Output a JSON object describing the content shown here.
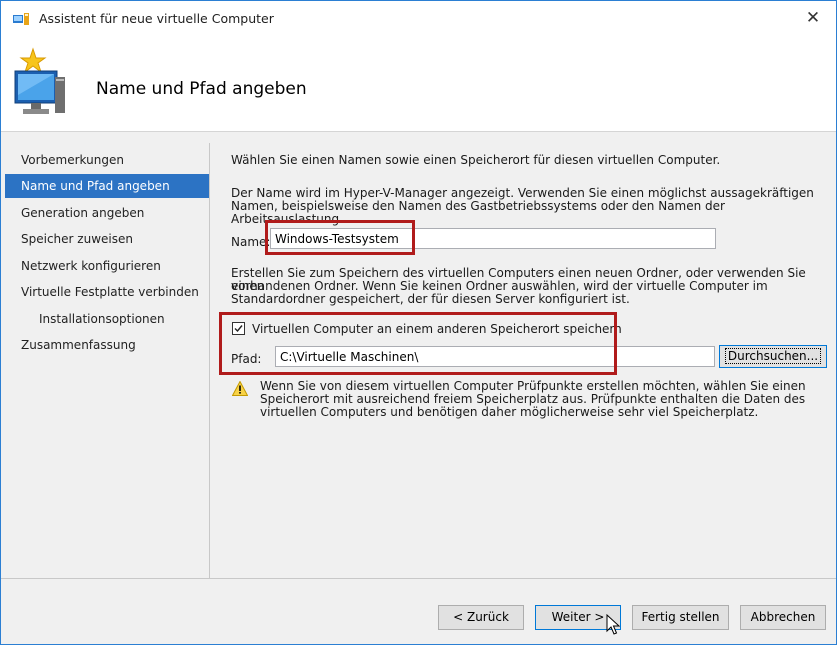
{
  "window": {
    "title": "Assistent für neue virtuelle Computer",
    "close_glyph": "✕"
  },
  "header": {
    "title": "Name und Pfad angeben",
    "icon": "monitor-star-icon"
  },
  "sidebar": {
    "items": [
      {
        "label": "Vorbemerkungen",
        "active": false,
        "indent": false
      },
      {
        "label": "Name und Pfad angeben",
        "active": true,
        "indent": false
      },
      {
        "label": "Generation angeben",
        "active": false,
        "indent": false
      },
      {
        "label": "Speicher zuweisen",
        "active": false,
        "indent": false
      },
      {
        "label": "Netzwerk konfigurieren",
        "active": false,
        "indent": false
      },
      {
        "label": "Virtuelle Festplatte verbinden",
        "active": false,
        "indent": false
      },
      {
        "label": "Installationsoptionen",
        "active": false,
        "indent": true
      },
      {
        "label": "Zusammenfassung",
        "active": false,
        "indent": false
      }
    ]
  },
  "main": {
    "intro": "Wählen Sie einen Namen sowie einen Speicherort für diesen virtuellen Computer.",
    "name_desc_1": "Der Name wird im Hyper-V-Manager angezeigt. Verwenden Sie einen möglichst aussagekräftigen",
    "name_desc_2": "Namen, beispielsweise den Namen des Gastbetriebssystems oder den Namen der Arbeitsauslastung.",
    "name_label": "Name:",
    "name_value": "Windows-Testsystem",
    "folder_desc_1": "Erstellen Sie zum Speichern des virtuellen Computers einen neuen Ordner, oder verwenden Sie einen",
    "folder_desc_2": "vorhandenen Ordner. Wenn Sie keinen Ordner auswählen, wird der virtuelle Computer im",
    "folder_desc_3": "Standardordner gespeichert, der für diesen Server konfiguriert ist.",
    "checkbox_label": "Virtuellen Computer an einem anderen Speicherort speichern",
    "checkbox_checked": true,
    "path_label": "Pfad:",
    "path_value": "C:\\Virtuelle Maschinen\\",
    "browse_label": "Durchsuchen...",
    "warning_1": "Wenn Sie von diesem virtuellen Computer Prüfpunkte erstellen möchten, wählen Sie einen",
    "warning_2": "Speicherort mit ausreichend freiem Speicherplatz aus. Prüfpunkte enthalten die Daten des",
    "warning_3": "virtuellen Computers und benötigen daher möglicherweise sehr viel Speicherplatz."
  },
  "footer": {
    "back_label": "< Zurück",
    "next_label": "Weiter >",
    "finish_label": "Fertig stellen",
    "cancel_label": "Abbrechen"
  },
  "colors": {
    "accent": "#2c73c4",
    "highlight_box": "#b01b1b",
    "border": "#2b7fd3"
  }
}
